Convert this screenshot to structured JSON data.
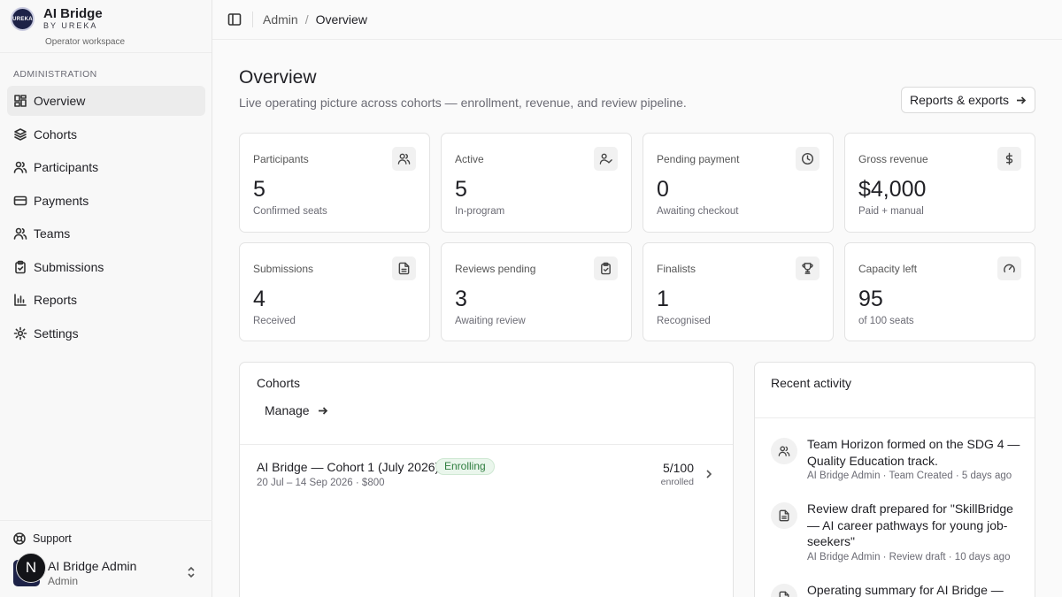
{
  "brand": {
    "name": "AI Bridge",
    "by": "BY UREKA",
    "workspace": "Operator workspace",
    "logo_text": "UREKA"
  },
  "sidebar": {
    "section_label": "ADMINISTRATION",
    "items": [
      {
        "label": "Overview",
        "icon": "dashboard-icon",
        "active": true
      },
      {
        "label": "Cohorts",
        "icon": "layers-icon"
      },
      {
        "label": "Participants",
        "icon": "users-icon"
      },
      {
        "label": "Payments",
        "icon": "credit-card-icon"
      },
      {
        "label": "Teams",
        "icon": "team-icon"
      },
      {
        "label": "Submissions",
        "icon": "clipboard-icon"
      },
      {
        "label": "Reports",
        "icon": "bar-chart-icon"
      },
      {
        "label": "Settings",
        "icon": "gear-icon"
      }
    ],
    "support": "Support",
    "user": {
      "initial": "N",
      "name": "AI Bridge Admin",
      "role": "Admin"
    }
  },
  "topbar": {
    "breadcrumb": [
      "Admin",
      "Overview"
    ]
  },
  "page": {
    "title": "Overview",
    "subtitle": "Live operating picture across cohorts — enrollment, revenue, and review pipeline.",
    "reports_button": "Reports & exports"
  },
  "stats": [
    {
      "label": "Participants",
      "value": "5",
      "sub": "Confirmed seats",
      "icon": "users-icon"
    },
    {
      "label": "Active",
      "value": "5",
      "sub": "In-program",
      "icon": "user-check-icon"
    },
    {
      "label": "Pending payment",
      "value": "0",
      "sub": "Awaiting checkout",
      "icon": "clock-icon"
    },
    {
      "label": "Gross revenue",
      "value": "$4,000",
      "sub": "Paid + manual",
      "icon": "dollar-icon"
    },
    {
      "label": "Submissions",
      "value": "4",
      "sub": "Received",
      "icon": "file-icon"
    },
    {
      "label": "Reviews pending",
      "value": "3",
      "sub": "Awaiting review",
      "icon": "clipboard-check-icon"
    },
    {
      "label": "Finalists",
      "value": "1",
      "sub": "Recognised",
      "icon": "trophy-icon"
    },
    {
      "label": "Capacity left",
      "value": "95",
      "sub": "of 100 seats",
      "icon": "gauge-icon"
    }
  ],
  "cohorts": {
    "heading": "Cohorts",
    "manage": "Manage",
    "rows": [
      {
        "name": "AI Bridge — Cohort 1 (July 2026)",
        "status": "Enrolling",
        "meta": "20 Jul – 14 Sep 2026 · $800",
        "count": "5/100",
        "count_label": "enrolled"
      }
    ]
  },
  "activity": {
    "heading": "Recent activity",
    "items": [
      {
        "text": "Team Horizon formed on the SDG 4 — Quality Education track.",
        "meta": "AI Bridge Admin · Team Created · 5 days ago",
        "icon": "users-icon"
      },
      {
        "text": "Review draft prepared for \"SkillBridge — AI career pathways for young job-seekers\"",
        "meta": "AI Bridge Admin · Review draft · 10 days ago",
        "icon": "file-icon"
      },
      {
        "text": "Operating summary for AI Bridge —",
        "meta": "",
        "icon": "file-icon"
      }
    ]
  },
  "colors": {
    "accent_dark": "#1d2247",
    "badge_green": "#2e7d3e",
    "badge_bg": "#eaf6ec"
  }
}
